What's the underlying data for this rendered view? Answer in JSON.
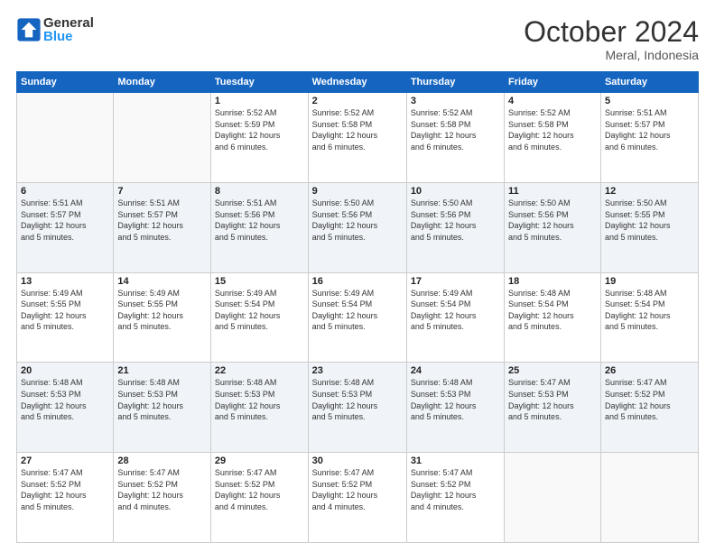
{
  "header": {
    "logo_general": "General",
    "logo_blue": "Blue",
    "month_title": "October 2024",
    "location": "Meral, Indonesia"
  },
  "weekdays": [
    "Sunday",
    "Monday",
    "Tuesday",
    "Wednesday",
    "Thursday",
    "Friday",
    "Saturday"
  ],
  "weeks": [
    [
      {
        "day": "",
        "info": ""
      },
      {
        "day": "",
        "info": ""
      },
      {
        "day": "1",
        "info": "Sunrise: 5:52 AM\nSunset: 5:59 PM\nDaylight: 12 hours\nand 6 minutes."
      },
      {
        "day": "2",
        "info": "Sunrise: 5:52 AM\nSunset: 5:58 PM\nDaylight: 12 hours\nand 6 minutes."
      },
      {
        "day": "3",
        "info": "Sunrise: 5:52 AM\nSunset: 5:58 PM\nDaylight: 12 hours\nand 6 minutes."
      },
      {
        "day": "4",
        "info": "Sunrise: 5:52 AM\nSunset: 5:58 PM\nDaylight: 12 hours\nand 6 minutes."
      },
      {
        "day": "5",
        "info": "Sunrise: 5:51 AM\nSunset: 5:57 PM\nDaylight: 12 hours\nand 6 minutes."
      }
    ],
    [
      {
        "day": "6",
        "info": "Sunrise: 5:51 AM\nSunset: 5:57 PM\nDaylight: 12 hours\nand 5 minutes."
      },
      {
        "day": "7",
        "info": "Sunrise: 5:51 AM\nSunset: 5:57 PM\nDaylight: 12 hours\nand 5 minutes."
      },
      {
        "day": "8",
        "info": "Sunrise: 5:51 AM\nSunset: 5:56 PM\nDaylight: 12 hours\nand 5 minutes."
      },
      {
        "day": "9",
        "info": "Sunrise: 5:50 AM\nSunset: 5:56 PM\nDaylight: 12 hours\nand 5 minutes."
      },
      {
        "day": "10",
        "info": "Sunrise: 5:50 AM\nSunset: 5:56 PM\nDaylight: 12 hours\nand 5 minutes."
      },
      {
        "day": "11",
        "info": "Sunrise: 5:50 AM\nSunset: 5:56 PM\nDaylight: 12 hours\nand 5 minutes."
      },
      {
        "day": "12",
        "info": "Sunrise: 5:50 AM\nSunset: 5:55 PM\nDaylight: 12 hours\nand 5 minutes."
      }
    ],
    [
      {
        "day": "13",
        "info": "Sunrise: 5:49 AM\nSunset: 5:55 PM\nDaylight: 12 hours\nand 5 minutes."
      },
      {
        "day": "14",
        "info": "Sunrise: 5:49 AM\nSunset: 5:55 PM\nDaylight: 12 hours\nand 5 minutes."
      },
      {
        "day": "15",
        "info": "Sunrise: 5:49 AM\nSunset: 5:54 PM\nDaylight: 12 hours\nand 5 minutes."
      },
      {
        "day": "16",
        "info": "Sunrise: 5:49 AM\nSunset: 5:54 PM\nDaylight: 12 hours\nand 5 minutes."
      },
      {
        "day": "17",
        "info": "Sunrise: 5:49 AM\nSunset: 5:54 PM\nDaylight: 12 hours\nand 5 minutes."
      },
      {
        "day": "18",
        "info": "Sunrise: 5:48 AM\nSunset: 5:54 PM\nDaylight: 12 hours\nand 5 minutes."
      },
      {
        "day": "19",
        "info": "Sunrise: 5:48 AM\nSunset: 5:54 PM\nDaylight: 12 hours\nand 5 minutes."
      }
    ],
    [
      {
        "day": "20",
        "info": "Sunrise: 5:48 AM\nSunset: 5:53 PM\nDaylight: 12 hours\nand 5 minutes."
      },
      {
        "day": "21",
        "info": "Sunrise: 5:48 AM\nSunset: 5:53 PM\nDaylight: 12 hours\nand 5 minutes."
      },
      {
        "day": "22",
        "info": "Sunrise: 5:48 AM\nSunset: 5:53 PM\nDaylight: 12 hours\nand 5 minutes."
      },
      {
        "day": "23",
        "info": "Sunrise: 5:48 AM\nSunset: 5:53 PM\nDaylight: 12 hours\nand 5 minutes."
      },
      {
        "day": "24",
        "info": "Sunrise: 5:48 AM\nSunset: 5:53 PM\nDaylight: 12 hours\nand 5 minutes."
      },
      {
        "day": "25",
        "info": "Sunrise: 5:47 AM\nSunset: 5:53 PM\nDaylight: 12 hours\nand 5 minutes."
      },
      {
        "day": "26",
        "info": "Sunrise: 5:47 AM\nSunset: 5:52 PM\nDaylight: 12 hours\nand 5 minutes."
      }
    ],
    [
      {
        "day": "27",
        "info": "Sunrise: 5:47 AM\nSunset: 5:52 PM\nDaylight: 12 hours\nand 5 minutes."
      },
      {
        "day": "28",
        "info": "Sunrise: 5:47 AM\nSunset: 5:52 PM\nDaylight: 12 hours\nand 4 minutes."
      },
      {
        "day": "29",
        "info": "Sunrise: 5:47 AM\nSunset: 5:52 PM\nDaylight: 12 hours\nand 4 minutes."
      },
      {
        "day": "30",
        "info": "Sunrise: 5:47 AM\nSunset: 5:52 PM\nDaylight: 12 hours\nand 4 minutes."
      },
      {
        "day": "31",
        "info": "Sunrise: 5:47 AM\nSunset: 5:52 PM\nDaylight: 12 hours\nand 4 minutes."
      },
      {
        "day": "",
        "info": ""
      },
      {
        "day": "",
        "info": ""
      }
    ]
  ]
}
